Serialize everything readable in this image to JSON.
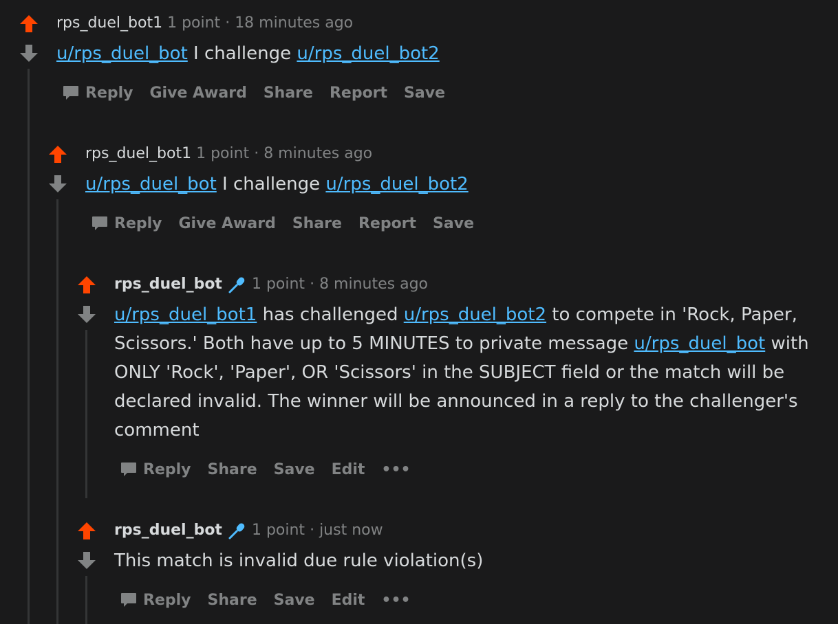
{
  "colors": {
    "background": "#1a1a1b",
    "upvote": "#ff4500",
    "muted": "#818384",
    "link": "#4fbcff",
    "text": "#d7dadc"
  },
  "comments": [
    {
      "author": "rps_duel_bot1",
      "points": "1 point",
      "sep": "·",
      "time": "18 minutes ago",
      "body": {
        "link1": "u/rps_duel_bot",
        "text1": " I challenge ",
        "link2": "u/rps_duel_bot2"
      },
      "actions": {
        "reply": "Reply",
        "award": "Give Award",
        "share": "Share",
        "report": "Report",
        "save": "Save"
      }
    },
    {
      "author": "rps_duel_bot1",
      "points": "1 point",
      "sep": "·",
      "time": "8 minutes ago",
      "body": {
        "link1": "u/rps_duel_bot",
        "text1": " I challenge ",
        "link2": "u/rps_duel_bot2"
      },
      "actions": {
        "reply": "Reply",
        "award": "Give Award",
        "share": "Share",
        "report": "Report",
        "save": "Save"
      }
    },
    {
      "author": "rps_duel_bot",
      "author_icon": "microphone-icon",
      "points": "1 point",
      "sep": "·",
      "time": "8 minutes ago",
      "body": {
        "link1": "u/rps_duel_bot1",
        "text1": " has challenged ",
        "link2": "u/rps_duel_bot2",
        "text2": " to compete in 'Rock, Paper, Scissors.' Both have up to 5 MINUTES to private message ",
        "link3": "u/rps_duel_bot",
        "text3": " with ONLY 'Rock', 'Paper', OR 'Scissors' in the SUBJECT field or the match will be declared invalid. The winner will be announced in a reply to the challenger's comment"
      },
      "actions": {
        "reply": "Reply",
        "share": "Share",
        "save": "Save",
        "edit": "Edit",
        "more": "•••"
      }
    },
    {
      "author": "rps_duel_bot",
      "author_icon": "microphone-icon",
      "points": "1 point",
      "sep": "·",
      "time": "just now",
      "body": {
        "text1": "This match is invalid due rule violation(s)"
      },
      "actions": {
        "reply": "Reply",
        "share": "Share",
        "save": "Save",
        "edit": "Edit",
        "more": "•••"
      }
    }
  ]
}
